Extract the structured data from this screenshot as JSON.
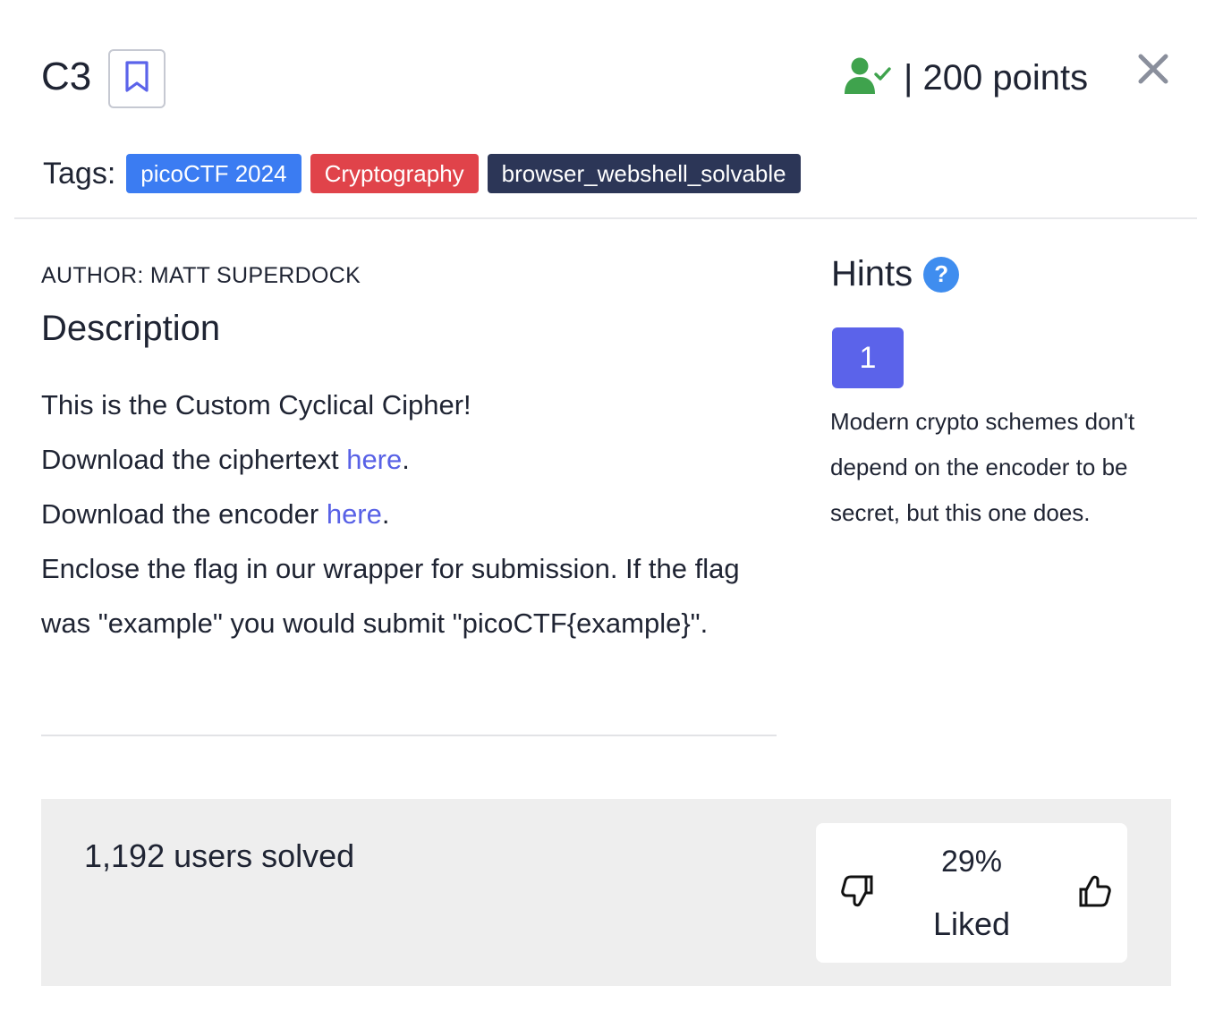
{
  "header": {
    "title": "C3",
    "points_text": "| 200 points"
  },
  "tags": {
    "label": "Tags:",
    "items": [
      {
        "label": "picoCTF 2024",
        "color": "#3b7cf2"
      },
      {
        "label": "Cryptography",
        "color": "#e0434a"
      },
      {
        "label": "browser_webshell_solvable",
        "color": "#2c3657"
      }
    ]
  },
  "author": "AUTHOR: MATT SUPERDOCK",
  "description": {
    "heading": "Description",
    "line1": "This is the Custom Cyclical Cipher!",
    "line2_prefix": "Download the ciphertext ",
    "line2_link": "here",
    "line2_suffix": ".",
    "line3_prefix": "Download the encoder ",
    "line3_link": "here",
    "line3_suffix": ".",
    "line4": "Enclose the flag in our wrapper for submission. If the flag was \"example\" you would submit \"picoCTF{example}\"."
  },
  "hints": {
    "title": "Hints",
    "help_symbol": "?",
    "badge": "1",
    "text": "Modern crypto schemes don't depend on the encoder to be secret, but this one does."
  },
  "stats": {
    "solved_text": "1,192 users solved",
    "liked_percent": "29%",
    "liked_label": "Liked"
  },
  "colors": {
    "accent": "#5b63ea",
    "link": "#5861e6",
    "solved_icon": "#3fa34d",
    "help_icon": "#3f8def"
  },
  "icons": {
    "bookmark": "bookmark-icon",
    "solved": "user-check-icon",
    "close": "close-icon",
    "help": "question-circle-icon",
    "dislike": "thumbs-down-icon",
    "like": "thumbs-up-icon"
  }
}
